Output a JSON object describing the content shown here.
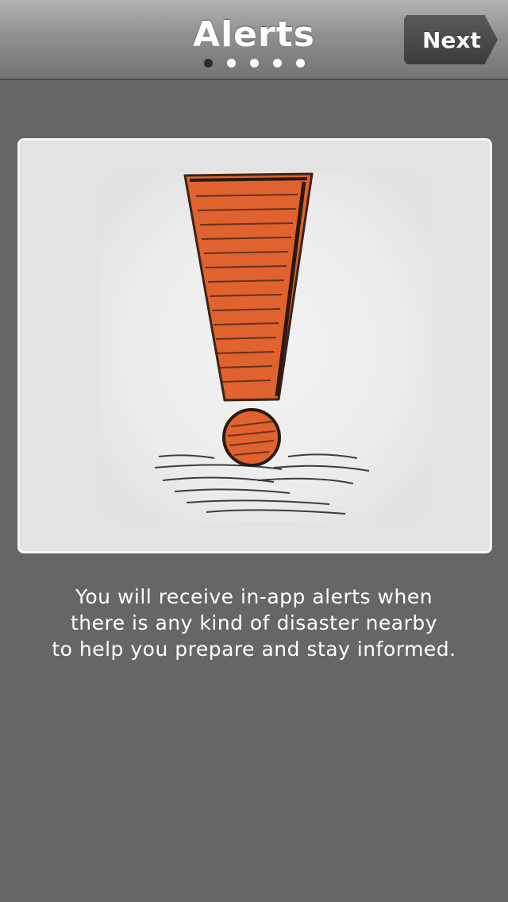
{
  "header": {
    "title": "Alerts",
    "next_label": "Next",
    "page_dots": {
      "count": 5,
      "active_index": 0
    }
  },
  "illustration": {
    "icon": "exclamation-mark-icon",
    "accent_color": "#e0622e"
  },
  "message": {
    "lines": [
      "You will receive in-app alerts when",
      "there is any kind of disaster nearby",
      "to help you prepare and stay informed."
    ]
  }
}
